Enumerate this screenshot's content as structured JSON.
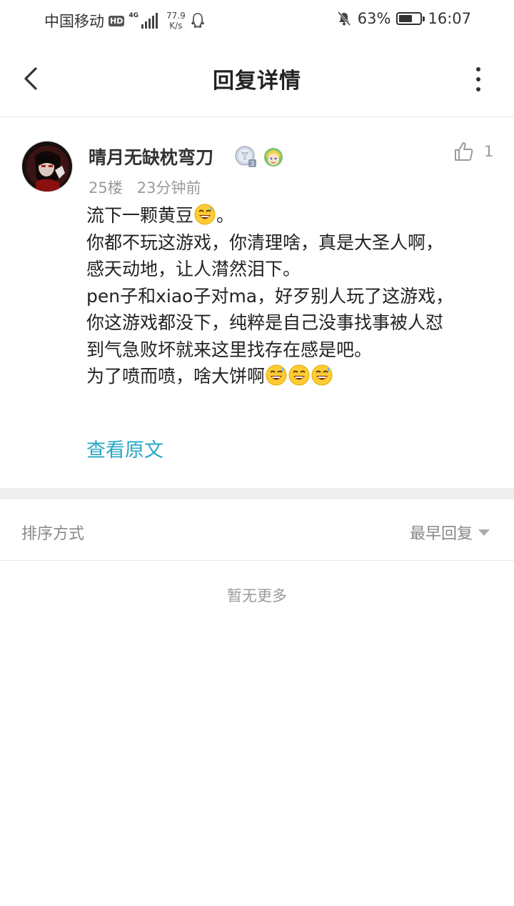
{
  "status_bar": {
    "carrier": "中国移动",
    "hd": "HD",
    "network": "4G",
    "speed_value": "77.9",
    "speed_unit": "K/s",
    "battery": "63%",
    "battery_level": 0.63,
    "time": "16:07"
  },
  "header": {
    "title": "回复详情"
  },
  "post": {
    "username": "晴月无缺枕弯刀",
    "floor": "25楼",
    "time_ago": "23分钟前",
    "like_count": "1",
    "lines": [
      "流下一颗黄豆",
      "。",
      "你都不玩这游戏，你清理啥，真是大圣人啊，",
      "感天动地，让人潸然泪下。",
      "pen子和xiao子对ma，好歹别人玩了这游戏，",
      "你这游戏都没下，纯粹是自己没事找事被人怼",
      "到气急败坏就来这里找存在感是吧。",
      "为了喷而喷，啥大饼啊"
    ],
    "view_original": "查看原文"
  },
  "sort": {
    "label": "排序方式",
    "value": "最早回复"
  },
  "empty_text": "暂无更多",
  "colors": {
    "accent": "#26a8c4",
    "separator": "#eeeeee"
  }
}
